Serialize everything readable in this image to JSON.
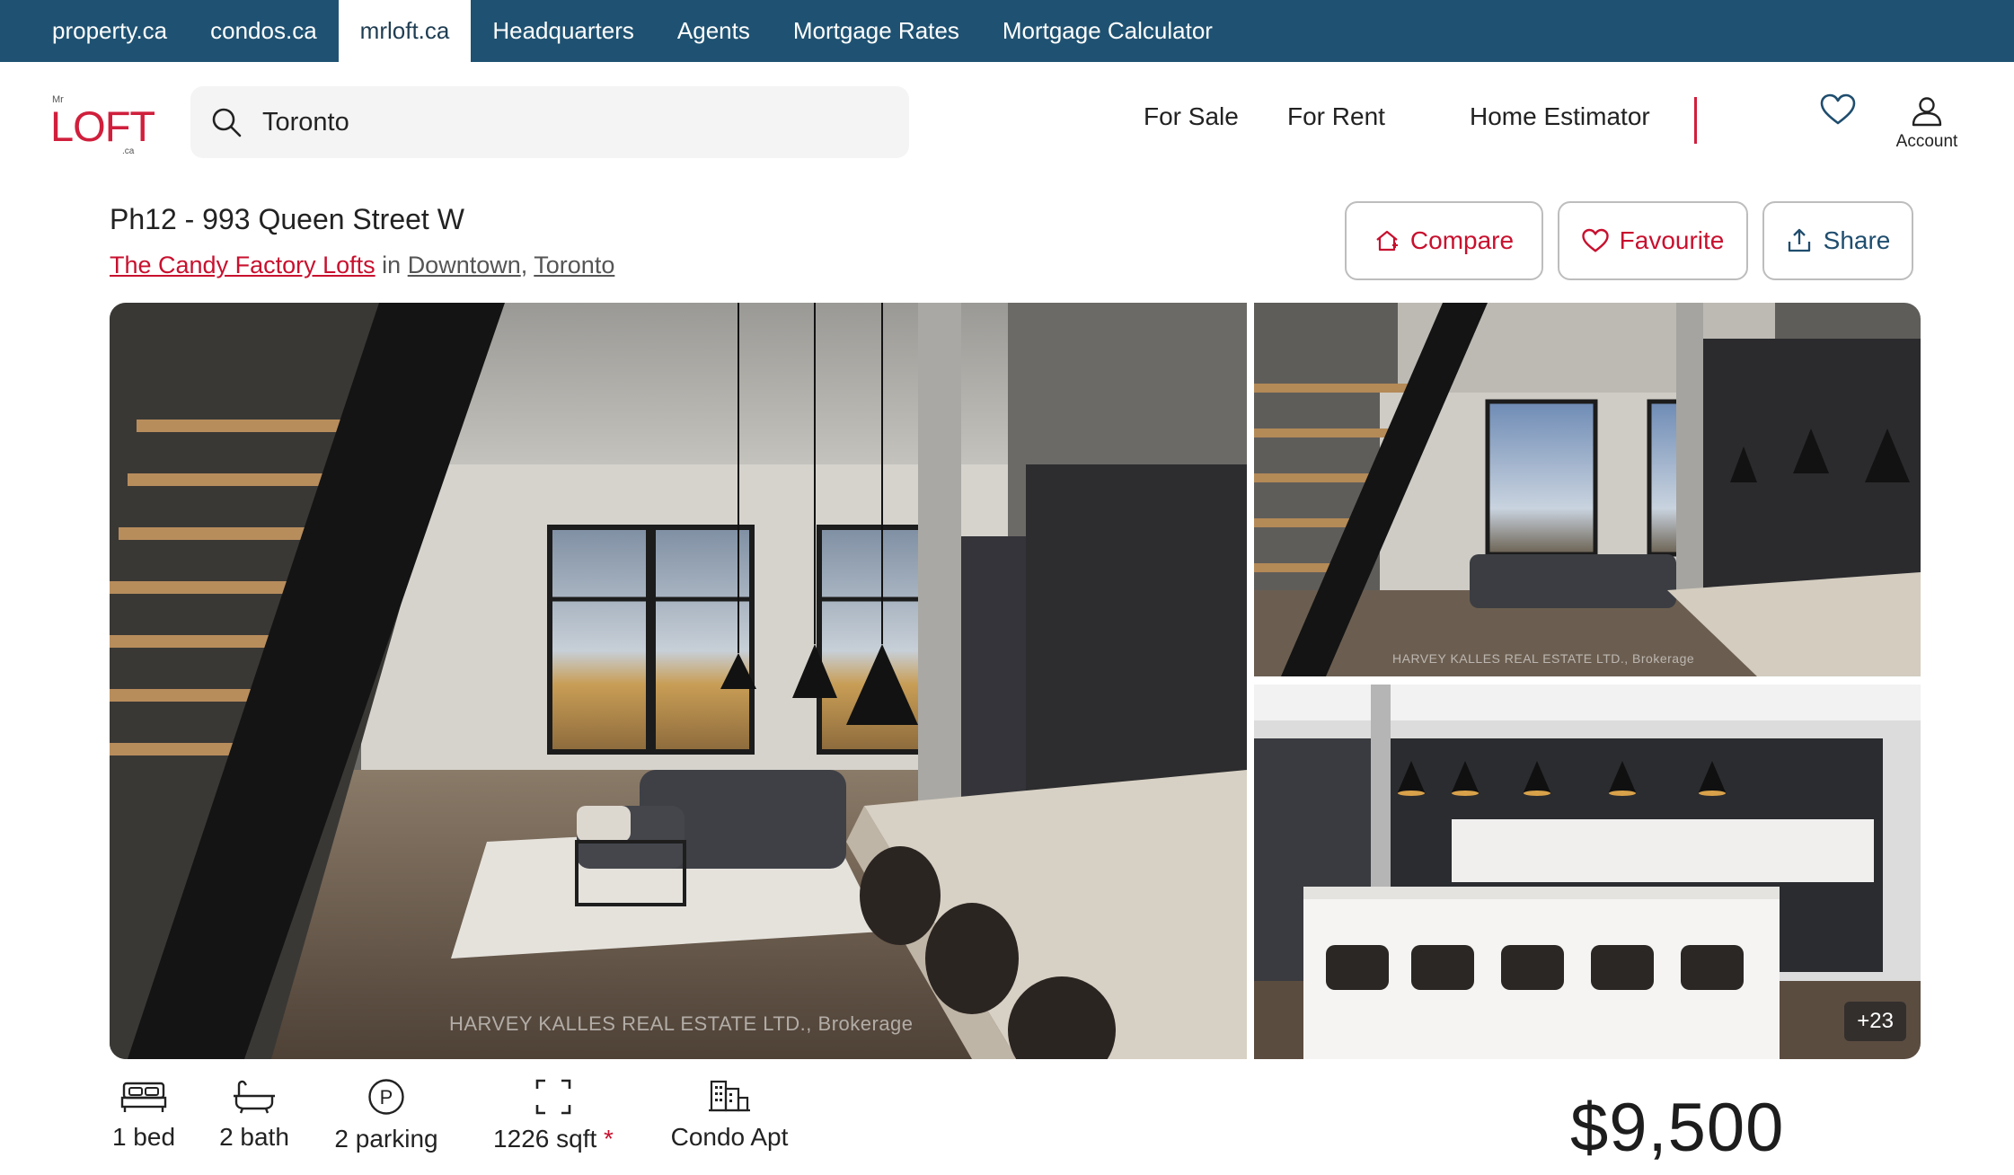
{
  "top_nav": {
    "items": [
      {
        "label": "property.ca"
      },
      {
        "label": "condos.ca"
      },
      {
        "label": "mrloft.ca",
        "active": true
      },
      {
        "label": "Headquarters"
      },
      {
        "label": "Agents"
      },
      {
        "label": "Mortgage Rates"
      },
      {
        "label": "Mortgage Calculator"
      }
    ],
    "bar_color": "#1f5272"
  },
  "logo": {
    "mr": "Mr",
    "word": "LOFT",
    "ca": ".ca",
    "color": "#d01f3c"
  },
  "search": {
    "value": "Toronto",
    "icon": "search-icon"
  },
  "main_nav": {
    "for_sale": "For Sale",
    "for_rent": "For Rent",
    "home_estimator": "Home Estimator",
    "account": "Account"
  },
  "listing": {
    "title": "Ph12 - 993 Queen Street W",
    "building": "The Candy Factory Lofts",
    "in_text": "in",
    "neighbourhood": "Downtown",
    "comma": ",",
    "city": "Toronto",
    "actions": {
      "compare": "Compare",
      "favourite": "Favourite",
      "share": "Share"
    },
    "watermark": "HARVEY KALLES REAL ESTATE LTD., Brokerage",
    "more_photos": "+23",
    "facts": {
      "beds": "1 bed",
      "baths": "2 bath",
      "parking": "2 parking",
      "sqft": "1226 sqft",
      "sqft_asterisk": "*",
      "type": "Condo Apt"
    },
    "price": "$9,500"
  },
  "colors": {
    "accent_red": "#c8102e",
    "brand_blue": "#1f4d6e"
  }
}
